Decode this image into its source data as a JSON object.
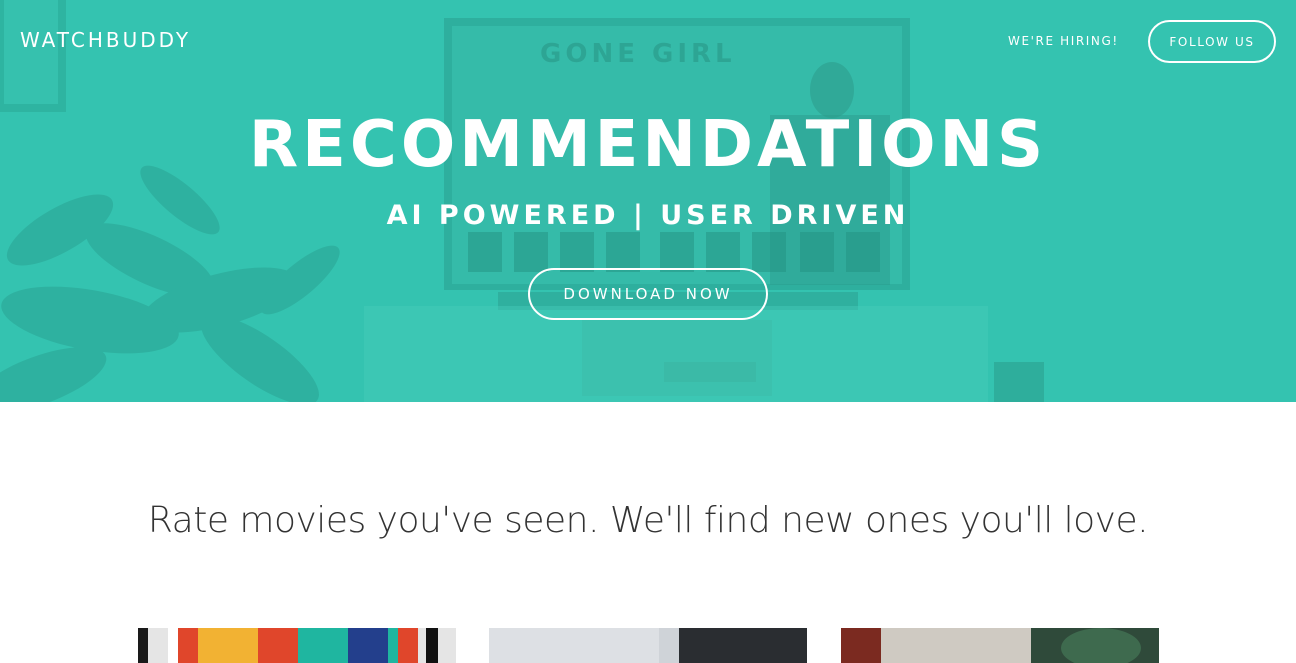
{
  "header": {
    "brand": "WATCHBUDDY",
    "nav_hiring": "WE'RE HIRING!",
    "follow_label": "FOLLOW US"
  },
  "hero": {
    "title": "RECOMMENDATIONS",
    "subtitle": "AI POWERED | USER DRIVEN",
    "download_label": "DOWNLOAD NOW",
    "background_tv_title": "GONE GIRL"
  },
  "main": {
    "tagline": "Rate movies you've seen. We'll find new ones you'll love."
  },
  "colors": {
    "accent": "#34c3b0",
    "text_dark": "#333333",
    "white": "#ffffff"
  }
}
